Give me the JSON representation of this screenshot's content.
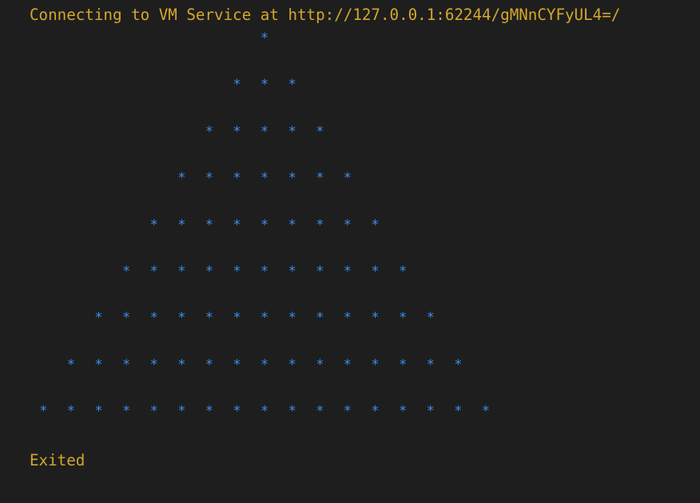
{
  "terminal": {
    "header_text": "Connecting to VM Service at http://127.0.0.1:62244/gMNnCYFyUL4=/",
    "footer_text": "Exited",
    "star_char": "*",
    "rows": [
      1,
      3,
      5,
      7,
      9,
      11,
      13,
      15,
      17
    ],
    "colors": {
      "background": "#1e1e1e",
      "info_text": "#d4a72c",
      "output_text": "#3b8eea"
    }
  }
}
